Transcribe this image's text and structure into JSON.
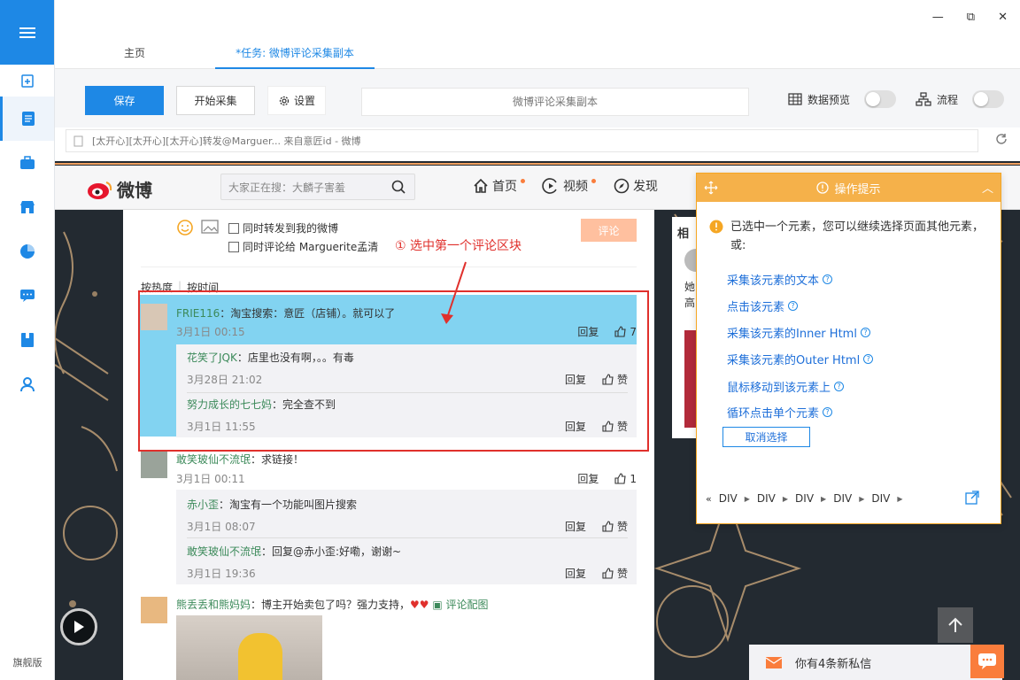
{
  "window": {
    "minimize": "—",
    "maximize": "⧉",
    "close": "✕"
  },
  "rail": {
    "footer_label": "旗舰版"
  },
  "tabs": [
    {
      "label": "主页"
    },
    {
      "label": "*任务: 微博评论采集副本"
    }
  ],
  "toolbar": {
    "save_label": "保存",
    "start_label": "开始采集",
    "settings_label": "设置",
    "task_name": "微博评论采集副本",
    "data_preview_label": "数据预览",
    "flow_label": "流程"
  },
  "urlbar": {
    "text": "[太开心][太开心][太开心]转发@Marguer... 来自意匠id - 微博"
  },
  "weibo": {
    "logo_text": "微博",
    "search_placeholder": "大家正在搜：大麟子害羞",
    "nav": [
      {
        "label": "首页"
      },
      {
        "label": "视频"
      },
      {
        "label": "发现"
      }
    ],
    "repost_option": "同时转发到我的微博",
    "comment_option": "同时评论给 Marguerite孟清",
    "comment_button": "评论",
    "sort_hot": "按热度",
    "sort_time": "按时间",
    "reply_label": "回复",
    "like_label": "赞",
    "comments": [
      {
        "author": "FRIE116",
        "text": "：淘宝搜索：意匠（店铺）。就可以了",
        "time": "3月1日 00:15",
        "likes": "7",
        "replies": [
          {
            "author": "花笑了JQK",
            "text": "：店里也没有啊，。。有毒",
            "time": "3月28日 21:02"
          },
          {
            "author": "努力成长的七七妈",
            "text": "：完全查不到",
            "time": "3月1日 11:55"
          }
        ]
      },
      {
        "author": "敢笑玻仙不流氓",
        "text": "：求链接！",
        "time": "3月1日 00:11",
        "likes": "1",
        "replies": [
          {
            "author": "赤小歪",
            "text": "：淘宝有一个功能叫图片搜索",
            "time": "3月1日 08:07"
          },
          {
            "author": "敢笑玻仙不流氓",
            "text": "：回复@赤小歪:好嘞，谢谢~",
            "time": "3月1日 19:36"
          }
        ]
      },
      {
        "author": "熊丢丢和熊妈妈",
        "text": "：博主开始卖包了吗？强力支持，",
        "image_label": "评论配图"
      }
    ],
    "side_peek": [
      "相",
      "她",
      "高"
    ],
    "chat_text": "你有4条新私信"
  },
  "annotation": "① 选中第一个评论区块",
  "panel": {
    "title": "操作提示",
    "message": "已选中一个元素，您可以继续选择页面其他元素，或:",
    "actions": [
      {
        "label": "采集该元素的文本"
      },
      {
        "label": "点击该元素"
      },
      {
        "label": "采集该元素的Inner Html"
      },
      {
        "label": "采集该元素的Outer Html"
      },
      {
        "label": "鼠标移动到该元素上"
      },
      {
        "label": "循环点击单个元素"
      }
    ],
    "cancel_label": "取消选择",
    "crumbs": [
      "DIV",
      "DIV",
      "DIV",
      "DIV",
      "DIV"
    ]
  },
  "colors": {
    "accent": "#1e88e5",
    "panel_header": "#f5b14a",
    "weibo_orange": "#fa7d3c",
    "highlight": "#58c4ec",
    "selection": "#e0302c"
  }
}
